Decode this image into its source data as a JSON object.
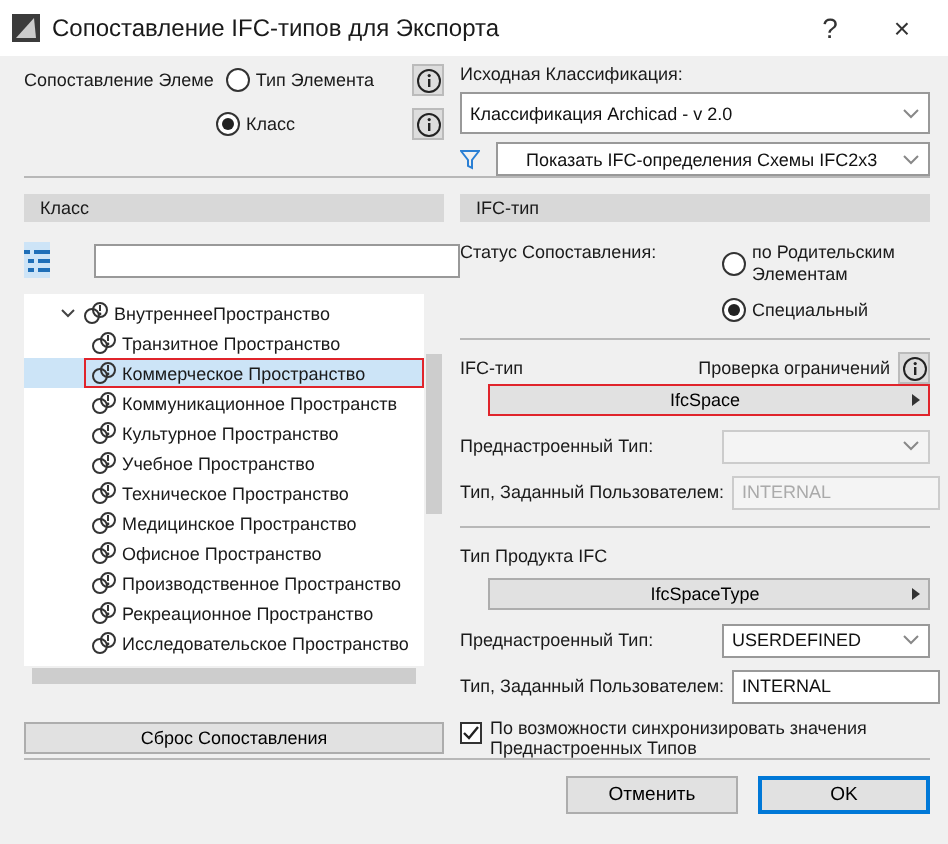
{
  "window": {
    "title": "Сопоставление IFC-типов для Экспорта",
    "help": "?",
    "close": "×"
  },
  "mapping": {
    "label": "Сопоставление Элеме",
    "options": [
      {
        "label": "Тип Элемента",
        "selected": false
      },
      {
        "label": "Класс",
        "selected": true
      }
    ]
  },
  "source": {
    "label": "Исходная Классификация:",
    "classification": "Классификация Archicad - v 2.0",
    "filter": "Показать IFC-определения Схемы IFC2x3"
  },
  "class_panel": {
    "title": "Класс",
    "tree": [
      {
        "label": "ВнутреннееПространство",
        "expanded": true,
        "selected": false,
        "highlighted": false,
        "children": [
          {
            "label": "Транзитное Пространство",
            "selected": false,
            "highlighted": false
          },
          {
            "label": "Коммерческое Пространство",
            "selected": true,
            "highlighted": true
          },
          {
            "label": "Коммуникационное Пространств",
            "selected": false,
            "highlighted": false
          },
          {
            "label": "Культурное Пространство",
            "selected": false,
            "highlighted": false
          },
          {
            "label": "Учебное Пространство",
            "selected": false,
            "highlighted": false
          },
          {
            "label": "Техническое Пространство",
            "selected": false,
            "highlighted": false
          },
          {
            "label": "Медицинское Пространство",
            "selected": false,
            "highlighted": false
          },
          {
            "label": "Офисное Пространство",
            "selected": false,
            "highlighted": false
          },
          {
            "label": "Производственное Пространство",
            "selected": false,
            "highlighted": false
          },
          {
            "label": "Рекреационное Пространство",
            "selected": false,
            "highlighted": false
          },
          {
            "label": "Исследовательское Пространство",
            "selected": false,
            "highlighted": false
          }
        ]
      }
    ],
    "reset_button": "Сброс Сопоставления"
  },
  "ifc_panel": {
    "title": "IFC-тип",
    "status": {
      "label": "Статус Сопоставления:",
      "options": [
        {
          "label": "по Родительским Элементам",
          "selected": false
        },
        {
          "label": "Специальный",
          "selected": true
        }
      ]
    },
    "ifc_type": {
      "label": "IFC-тип",
      "check_label": "Проверка ограничений",
      "value": "IfcSpace",
      "highlighted": true,
      "predefined": {
        "label": "Преднастроенный Тип:",
        "disabled": true
      },
      "user_defined": {
        "label": "Тип, Заданный Пользователем:",
        "value": "INTERNAL",
        "disabled": true
      }
    },
    "product_type": {
      "label": "Тип Продукта IFC",
      "value": "IfcSpaceType",
      "highlighted": false,
      "predefined": {
        "label": "Преднастроенный Тип:",
        "value": "USERDEFINED",
        "disabled": false
      },
      "user_defined": {
        "label": "Тип, Заданный Пользователем:",
        "value": "INTERNAL",
        "disabled": false
      }
    },
    "sync": {
      "label": "По возможности синхронизировать значения Преднастроенных Типов",
      "checked": true
    }
  },
  "buttons": [
    {
      "label": "Отменить",
      "default": false
    },
    {
      "label": "OK",
      "default": true
    }
  ]
}
